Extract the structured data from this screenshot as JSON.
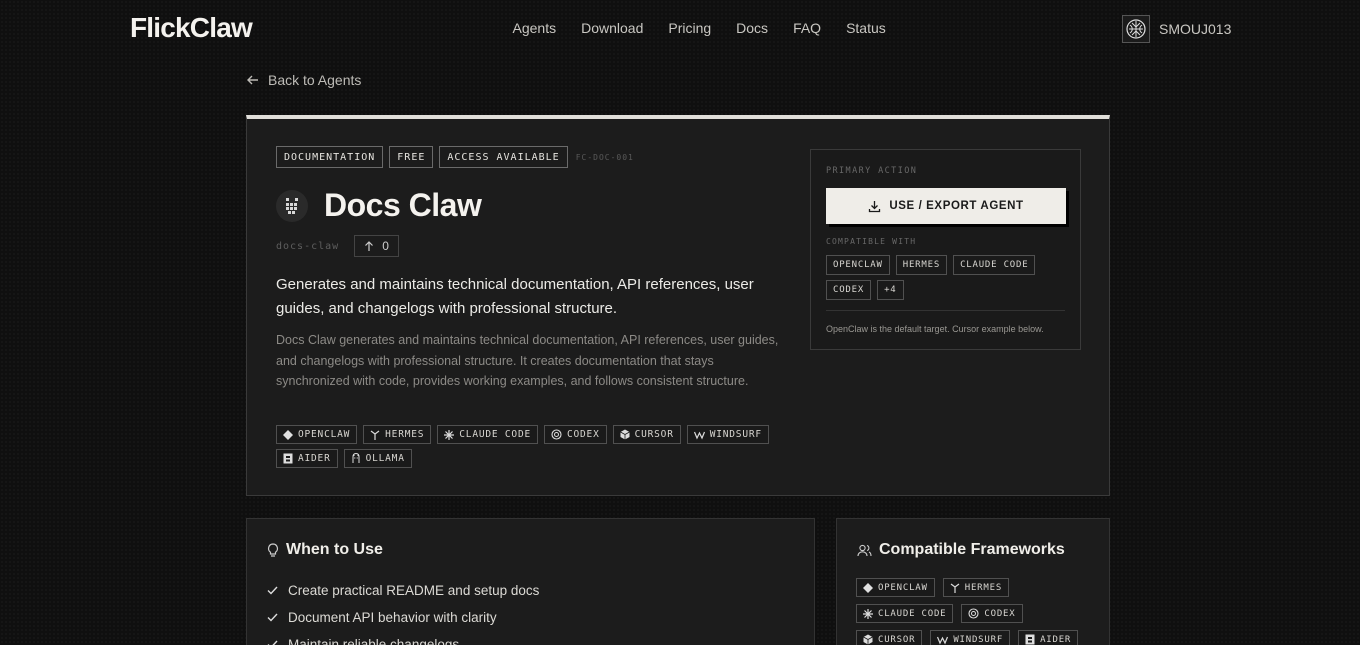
{
  "header": {
    "logo": "FlickClaw",
    "nav": [
      "Agents",
      "Download",
      "Pricing",
      "Docs",
      "FAQ",
      "Status"
    ],
    "username": "SMOUJ013"
  },
  "back_link": "Back to Agents",
  "agent": {
    "badges": [
      "DOCUMENTATION",
      "FREE",
      "ACCESS AVAILABLE"
    ],
    "code_id": "FC-DOC-001",
    "title": "Docs Claw",
    "slug": "docs-claw",
    "votes": "0",
    "lead": "Generates and maintains technical documentation, API references, user guides, and changelogs with professional structure.",
    "description": "Docs Claw generates and maintains technical documentation, API references, user guides, and changelogs with professional structure. It creates documentation that stays synchronized with code, provides working examples, and follows consistent structure.",
    "frameworks": [
      "OPENCLAW",
      "HERMES",
      "CLAUDE CODE",
      "CODEX",
      "CURSOR",
      "WINDSURF",
      "AIDER",
      "OLLAMA"
    ]
  },
  "primary_action": {
    "label": "PRIMARY ACTION",
    "button": "USE / EXPORT AGENT",
    "compatible_label": "COMPATIBLE WITH",
    "compatible": [
      "OPENCLAW",
      "HERMES",
      "CLAUDE CODE",
      "CODEX",
      "+4"
    ],
    "note": "OpenClaw is the default target. Cursor example below."
  },
  "when_to_use": {
    "title": "When to Use",
    "items": [
      "Create practical README and setup docs",
      "Document API behavior with clarity",
      "Maintain reliable changelogs"
    ]
  },
  "compatible_frameworks": {
    "title": "Compatible Frameworks",
    "items": [
      "OPENCLAW",
      "HERMES",
      "CLAUDE CODE",
      "CODEX",
      "CURSOR",
      "WINDSURF",
      "AIDER"
    ]
  }
}
